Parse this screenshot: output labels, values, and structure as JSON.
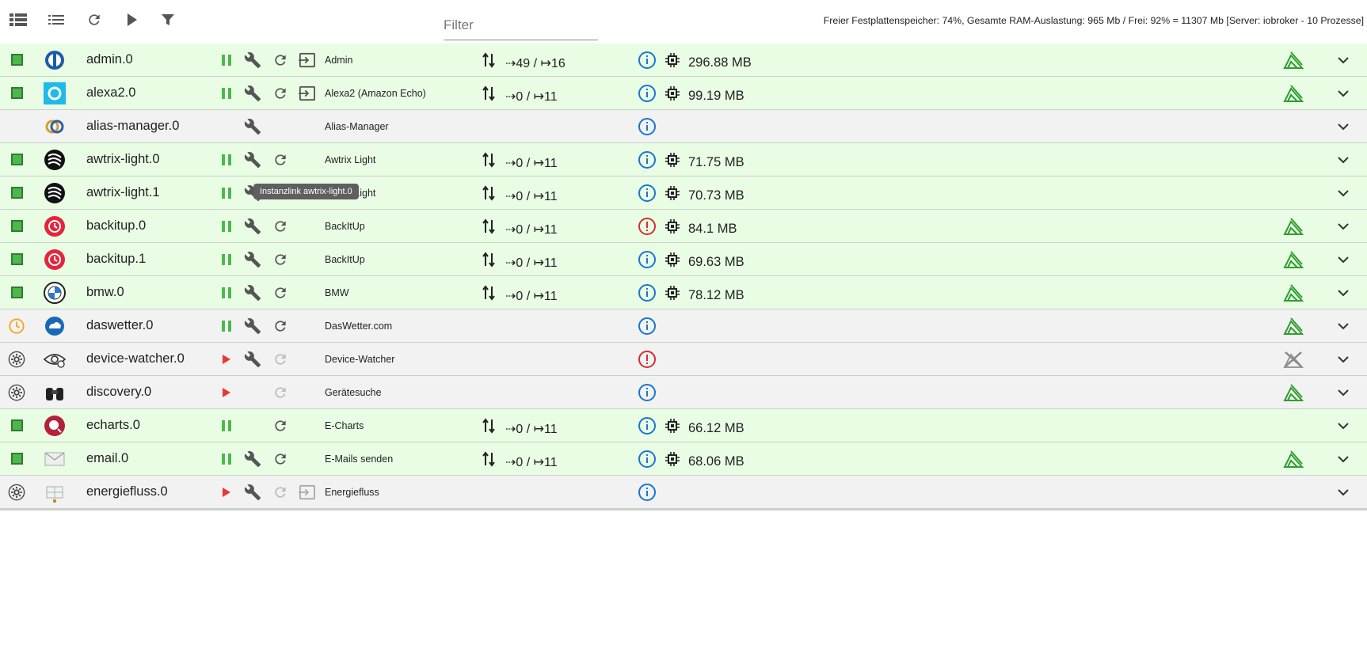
{
  "toolbar": {
    "filter_placeholder": "Filter",
    "status": "Freier Festplattenspeicher: 74%, Gesamte RAM-Auslastung: 965 Mb / Frei: 92% = 11307 Mb [Server: iobroker - 10 Prozesse]",
    "icons": [
      "list-expanded-icon",
      "list-compact-icon",
      "reload-icon",
      "play-icon",
      "filter-icon"
    ]
  },
  "colors": {
    "green_row": "#e9fde5",
    "grey_row": "#f2f2f2",
    "accent_green": "#4cb84c",
    "info_blue": "#1976d2",
    "error_red": "#d32f2f",
    "wifi_green": "#2e9e2e"
  },
  "tooltip": {
    "text": "Instanzlink awtrix-light.0"
  },
  "rows": [
    {
      "name": "admin.0",
      "title": "Admin",
      "io": "⇢49 / ↦16",
      "memory": "296.88 MB",
      "state": "running",
      "info": "info"
    },
    {
      "name": "alexa2.0",
      "title": "Alexa2 (Amazon Echo)",
      "io": "⇢0 / ↦11",
      "memory": "99.19 MB",
      "state": "running",
      "info": "info"
    },
    {
      "name": "alias-manager.0",
      "title": "Alias-Manager",
      "io": "",
      "memory": "",
      "state": "none",
      "info": "info"
    },
    {
      "name": "awtrix-light.0",
      "title": "Awtrix Light",
      "io": "⇢0 / ↦11",
      "memory": "71.75 MB",
      "state": "running",
      "info": "info"
    },
    {
      "name": "awtrix-light.1",
      "title": "Awtrix Light",
      "io": "⇢0 / ↦11",
      "memory": "70.73 MB",
      "state": "running",
      "info": "info"
    },
    {
      "name": "backitup.0",
      "title": "BackItUp",
      "io": "⇢0 / ↦11",
      "memory": "84.1 MB",
      "state": "running",
      "info": "error"
    },
    {
      "name": "backitup.1",
      "title": "BackItUp",
      "io": "⇢0 / ↦11",
      "memory": "69.63 MB",
      "state": "running",
      "info": "info"
    },
    {
      "name": "bmw.0",
      "title": "BMW",
      "io": "⇢0 / ↦11",
      "memory": "78.12 MB",
      "state": "running",
      "info": "info"
    },
    {
      "name": "daswetter.0",
      "title": "DasWetter.com",
      "io": "",
      "memory": "",
      "state": "scheduled",
      "info": "info"
    },
    {
      "name": "device-watcher.0",
      "title": "Device-Watcher",
      "io": "",
      "memory": "",
      "state": "stopped",
      "info": "error"
    },
    {
      "name": "discovery.0",
      "title": "Gerätesuche",
      "io": "",
      "memory": "",
      "state": "stopped",
      "info": "info"
    },
    {
      "name": "echarts.0",
      "title": "E-Charts",
      "io": "⇢0 / ↦11",
      "memory": "66.12 MB",
      "state": "running",
      "info": "info"
    },
    {
      "name": "email.0",
      "title": "E-Mails senden",
      "io": "⇢0 / ↦11",
      "memory": "68.06 MB",
      "state": "running",
      "info": "info"
    },
    {
      "name": "energiefluss.0",
      "title": "Energiefluss",
      "io": "",
      "memory": "",
      "state": "stopped",
      "info": "info"
    }
  ]
}
